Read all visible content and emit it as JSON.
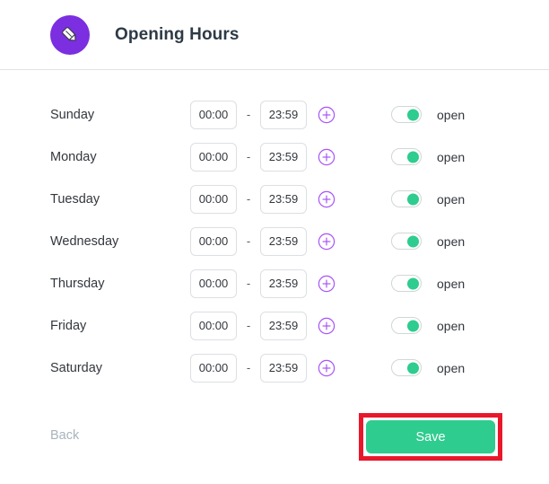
{
  "header": {
    "icon": "pencil-edit-icon",
    "icon_bg_color": "#7b2fe0",
    "title": "Opening Hours"
  },
  "schedule": {
    "time_separator": "-",
    "add_icon": "circled-plus-icon",
    "add_icon_color": "#a855f7",
    "toggle_on_color": "#2ecc8f",
    "rows": [
      {
        "day": "Sunday",
        "open_time": "00:00",
        "close_time": "23:59",
        "status_label": "open",
        "is_open": true
      },
      {
        "day": "Monday",
        "open_time": "00:00",
        "close_time": "23:59",
        "status_label": "open",
        "is_open": true
      },
      {
        "day": "Tuesday",
        "open_time": "00:00",
        "close_time": "23:59",
        "status_label": "open",
        "is_open": true
      },
      {
        "day": "Wednesday",
        "open_time": "00:00",
        "close_time": "23:59",
        "status_label": "open",
        "is_open": true
      },
      {
        "day": "Thursday",
        "open_time": "00:00",
        "close_time": "23:59",
        "status_label": "open",
        "is_open": true
      },
      {
        "day": "Friday",
        "open_time": "00:00",
        "close_time": "23:59",
        "status_label": "open",
        "is_open": true
      },
      {
        "day": "Saturday",
        "open_time": "00:00",
        "close_time": "23:59",
        "status_label": "open",
        "is_open": true
      }
    ]
  },
  "footer": {
    "back_label": "Back",
    "save_label": "Save",
    "save_color": "#2ecc8f",
    "highlight_color": "#e8182a"
  }
}
